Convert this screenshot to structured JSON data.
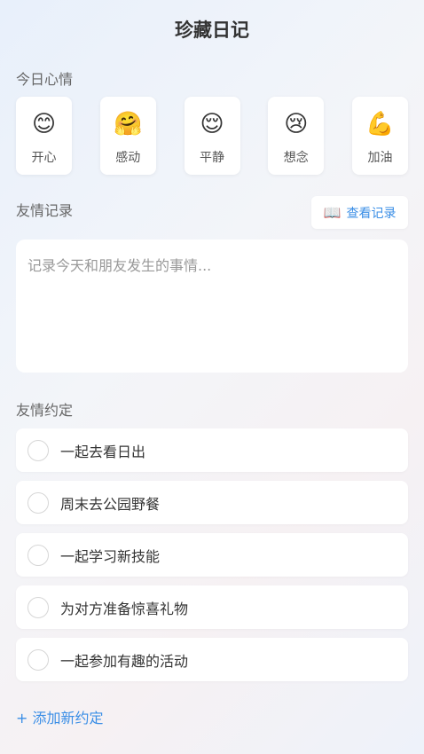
{
  "header": {
    "title": "珍藏日记"
  },
  "mood_section": {
    "label": "今日心情",
    "moods": [
      {
        "emoji": "😊",
        "label": "开心"
      },
      {
        "emoji": "🤗",
        "label": "感动"
      },
      {
        "emoji": "😌",
        "label": "平静"
      },
      {
        "emoji": "😢",
        "label": "想念"
      },
      {
        "emoji": "💪",
        "label": "加油"
      }
    ]
  },
  "friendship_record": {
    "label": "友情记录",
    "view_button_icon": "📖",
    "view_button_label": "查看记录",
    "placeholder": "记录今天和朋友发生的事情...",
    "value": ""
  },
  "promises_section": {
    "label": "友情约定",
    "items": [
      {
        "text": "一起去看日出",
        "checked": false
      },
      {
        "text": "周末去公园野餐",
        "checked": false
      },
      {
        "text": "一起学习新技能",
        "checked": false
      },
      {
        "text": "为对方准备惊喜礼物",
        "checked": false
      },
      {
        "text": "一起参加有趣的活动",
        "checked": false
      }
    ],
    "add_label": "+ 添加新约定"
  },
  "colors": {
    "accent": "#3a8ee6",
    "text": "#333333",
    "muted": "#666666"
  }
}
